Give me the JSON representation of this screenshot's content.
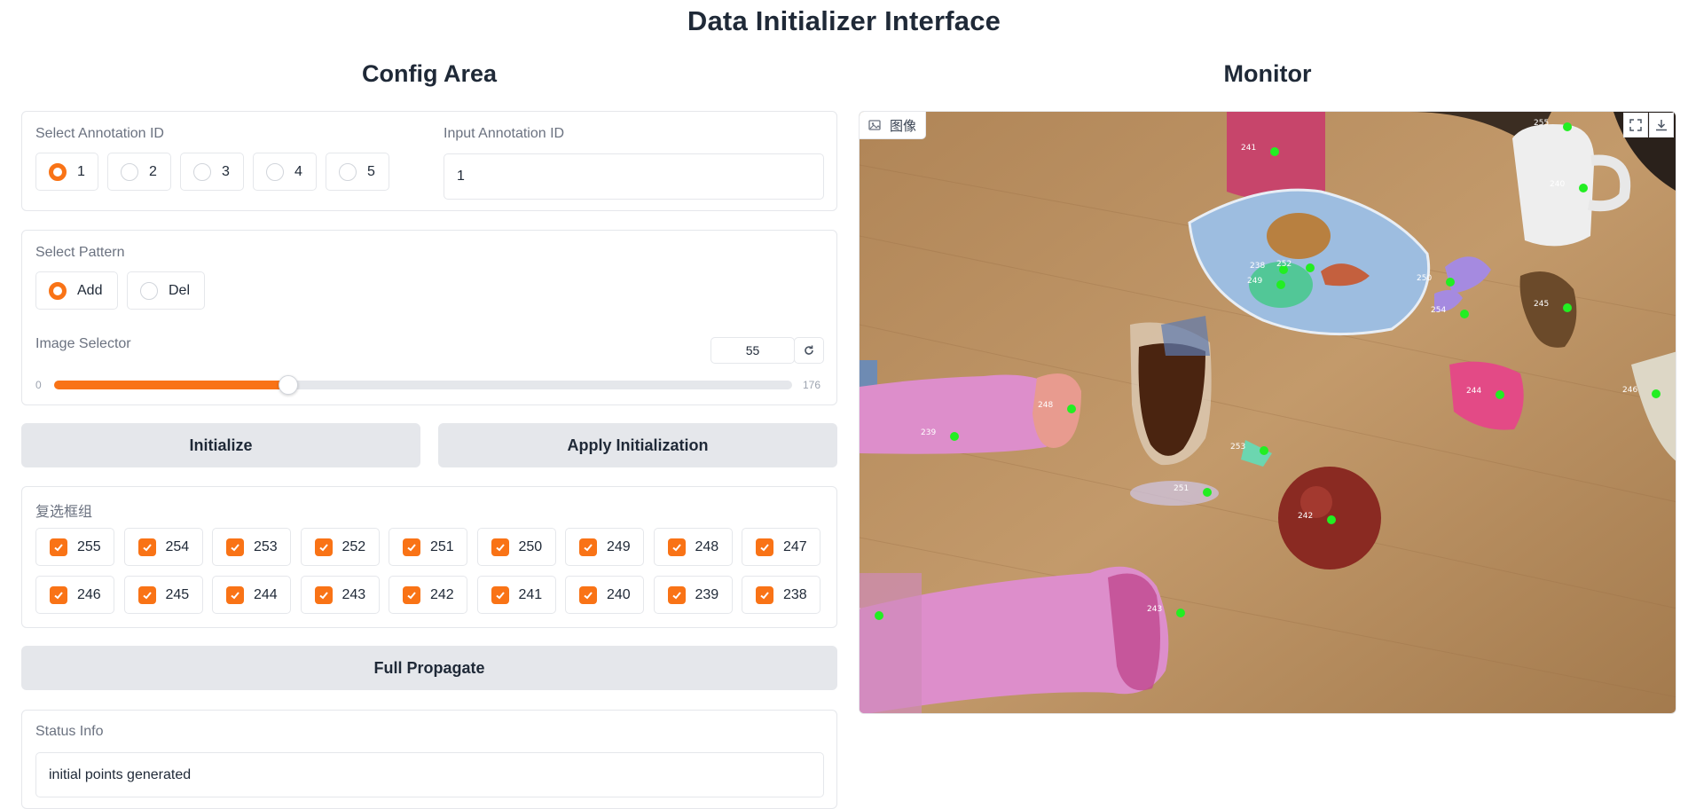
{
  "app": {
    "title": "Data Initializer Interface"
  },
  "config": {
    "title": "Config Area",
    "annotation": {
      "select_label": "Select Annotation ID",
      "options": [
        "1",
        "2",
        "3",
        "4",
        "5"
      ],
      "selected": "1",
      "input_label": "Input Annotation ID",
      "input_value": "1"
    },
    "pattern": {
      "label": "Select Pattern",
      "options": [
        "Add",
        "Del"
      ],
      "selected": "Add"
    },
    "image_selector": {
      "label": "Image Selector",
      "value": "55",
      "min": "0",
      "max": "176"
    },
    "buttons": {
      "initialize": "Initialize",
      "apply": "Apply Initialization",
      "full_propagate": "Full Propagate"
    },
    "checkbox_group": {
      "label": "复选框组",
      "items": [
        "255",
        "254",
        "253",
        "252",
        "251",
        "250",
        "249",
        "248",
        "247",
        "246",
        "245",
        "244",
        "243",
        "242",
        "241",
        "240",
        "239",
        "238"
      ],
      "checked": [
        "255",
        "254",
        "253",
        "252",
        "251",
        "250",
        "249",
        "248",
        "247",
        "246",
        "245",
        "244",
        "243",
        "242",
        "241",
        "240",
        "239",
        "238"
      ]
    },
    "status": {
      "label": "Status Info",
      "value": "initial points generated"
    }
  },
  "monitor": {
    "title": "Monitor",
    "image_tag": "图像",
    "icons": [
      "image-icon",
      "fullscreen-icon",
      "download-icon"
    ],
    "point_labels": [
      "241",
      "255",
      "240",
      "238",
      "252",
      "249",
      "250",
      "254",
      "245",
      "248",
      "239",
      "253",
      "244",
      "246",
      "251",
      "242",
      "243",
      "247"
    ]
  },
  "colors": {
    "accent": "#f97316",
    "point": "#22ee22",
    "button_bg": "#e5e7eb"
  }
}
